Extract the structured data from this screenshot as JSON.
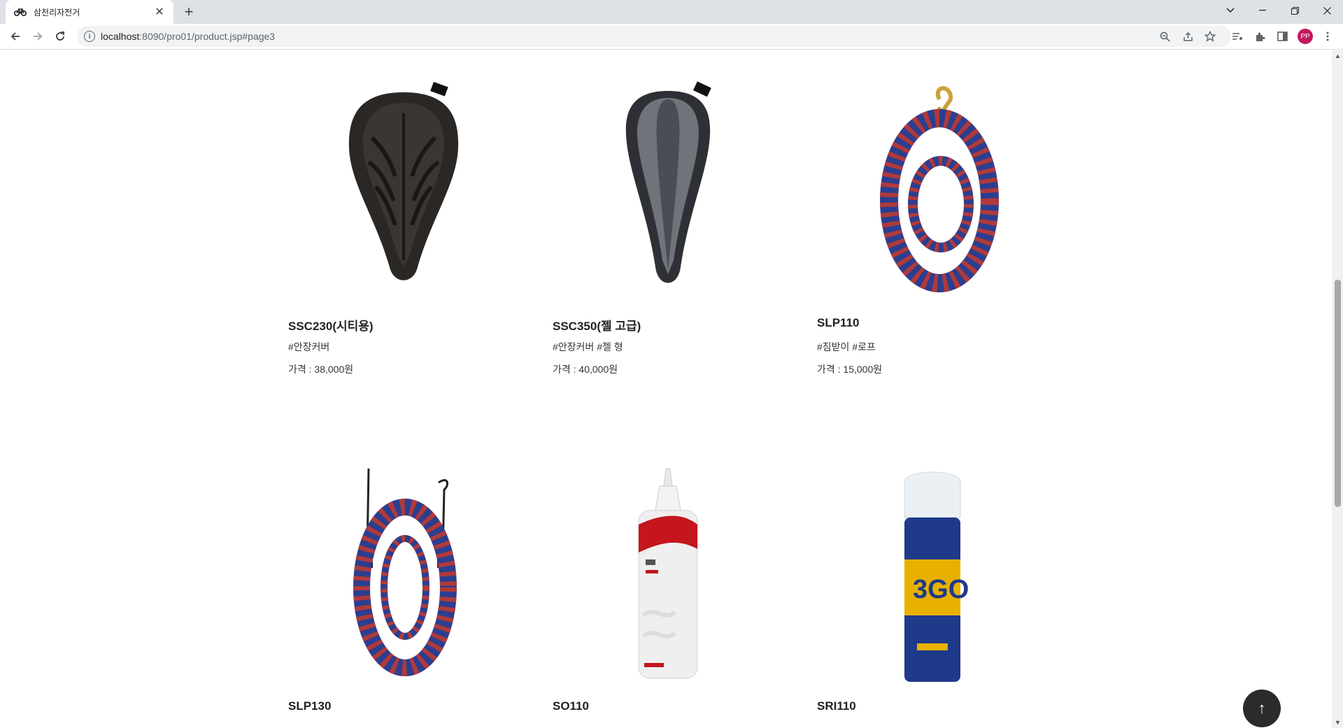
{
  "browser": {
    "tab_title": "삼천리자전거",
    "url_host": "localhost",
    "url_rest": ":8090/pro01/product.jsp#page3",
    "profile_initials": "PP",
    "profile_color": "#c2185b"
  },
  "products": [
    {
      "name": "SSC230(시티용)",
      "tags": "#안장커버",
      "price": "가격 : 38,000원",
      "image": "black-gel-saddle-cover"
    },
    {
      "name": "SSC350(젤 고급)",
      "tags": "#안장커버 #젤 형",
      "price": "가격 : 40,000원",
      "image": "grey-gel-saddle-cover"
    },
    {
      "name": "SLP110",
      "tags": "#짐받이 #로프",
      "price": "가격 : 15,000원",
      "image": "coiled-bungee-rope-hook"
    },
    {
      "name": "SLP130",
      "tags": "",
      "price": "",
      "image": "bungee-cord-two-hooks"
    },
    {
      "name": "SO110",
      "tags": "",
      "price": "",
      "image": "oil-bottle"
    },
    {
      "name": "SRI110",
      "tags": "",
      "price": "",
      "image": "spray-can-3go"
    }
  ],
  "back_to_top_label": "↑"
}
